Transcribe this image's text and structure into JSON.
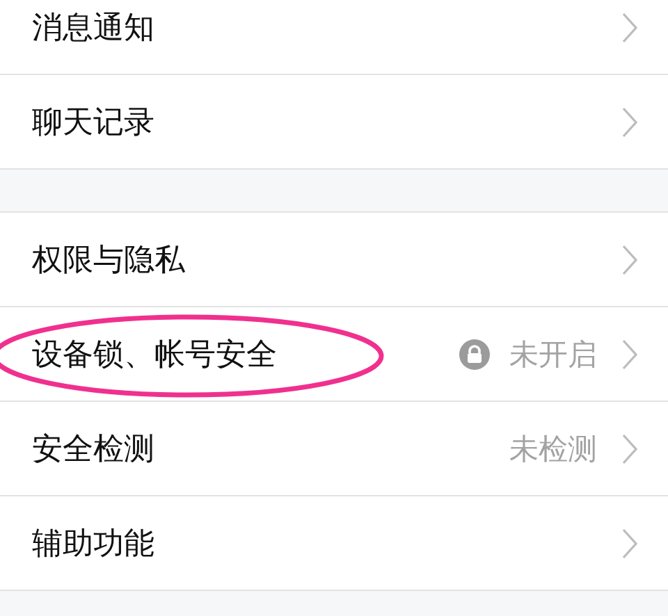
{
  "groups": [
    {
      "items": [
        {
          "label": "消息通知",
          "circled": false
        },
        {
          "label": "聊天记录",
          "circled": false
        }
      ]
    },
    {
      "items": [
        {
          "label": "权限与隐私",
          "circled": false
        },
        {
          "label": "设备锁、帐号安全",
          "circled": true,
          "status": {
            "text": "未开启",
            "kind": "locked"
          }
        },
        {
          "label": "安全检测",
          "circled": false,
          "status": {
            "text": "未检测",
            "kind": "plain"
          }
        },
        {
          "label": "辅助功能",
          "circled": false
        }
      ]
    }
  ]
}
